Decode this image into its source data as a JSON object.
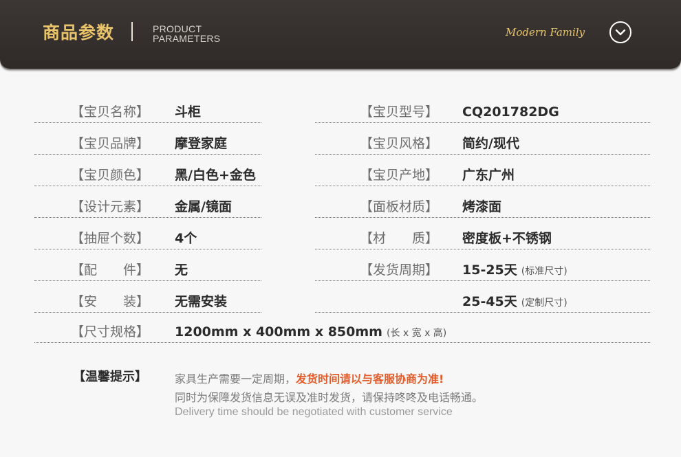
{
  "header": {
    "title_cn": "商品参数",
    "title_en_line1": "PRODUCT",
    "title_en_line2": "PARAMETERS",
    "brand_script": "Modern Family",
    "expand_icon": "chevron-down-circle-icon"
  },
  "params": {
    "name_label": "【宝贝名称】",
    "name_value": "斗柜",
    "model_label": "【宝贝型号】",
    "model_value": "CQ201782DG",
    "brand_label": "【宝贝品牌】",
    "brand_value": "摩登家庭",
    "style_label": "【宝贝风格】",
    "style_value": "简约/现代",
    "color_label": "【宝贝颜色】",
    "color_value": "黑/白色+金色",
    "origin_label": "【宝贝产地】",
    "origin_value": "广东广州",
    "design_label": "【设计元素】",
    "design_value": "金属/镜面",
    "panel_label": "【面板材质】",
    "panel_value": "烤漆面",
    "drawers_label": "【抽屉个数】",
    "drawers_value": "4个",
    "material_label": "【材　　质】",
    "material_value": "密度板+不锈钢",
    "parts_label": "【配　　件】",
    "parts_value": "无",
    "delivery_label": "【发货周期】",
    "delivery_value": "15-25天",
    "delivery_note": "(标准尺寸)",
    "install_label": "【安　　装】",
    "install_value": "无需安装",
    "delivery2_value": "25-45天",
    "delivery2_note": "(定制尺寸)",
    "size_label": "【尺寸规格】",
    "size_value": "1200mm x 400mm x 850mm",
    "size_note": "(长 x 宽 x 高)"
  },
  "tips": {
    "label": "【温馨提示】",
    "line1_a": "家具生产需要一定周期，",
    "line1_b": "发货时间请以与客服协商为准!",
    "line2": "同时为保障发货信息无误及准时发货，请保持咚咚及电话畅通。",
    "line3": "Delivery time should be negotiated with customer service"
  },
  "colors": {
    "header_bg": "#2f2a28",
    "accent_gold": "#e9c46a",
    "emphasis": "#e25d2b"
  }
}
